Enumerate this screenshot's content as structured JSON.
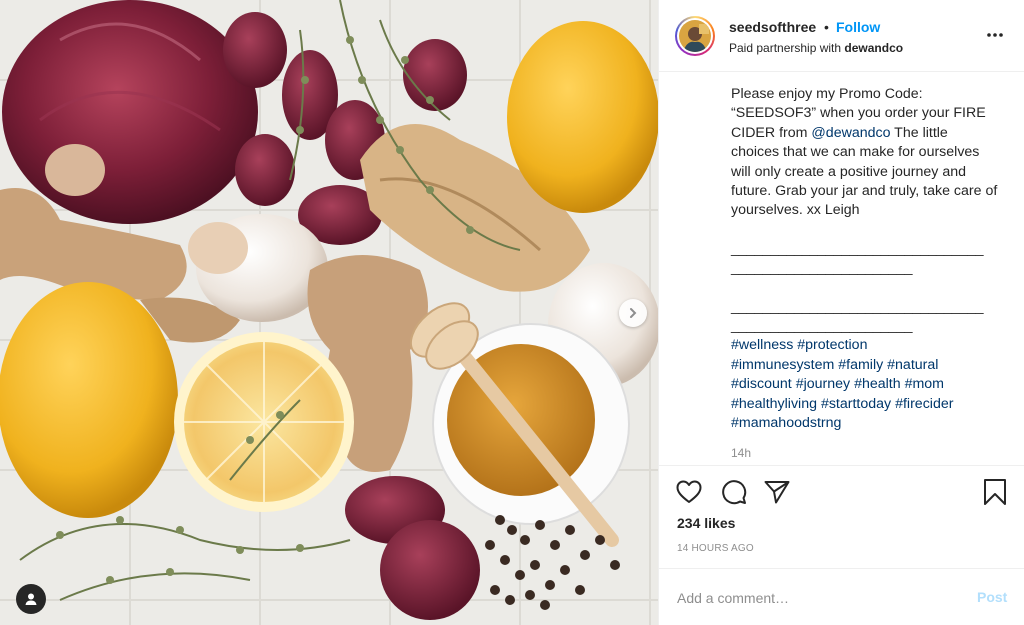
{
  "post": {
    "username": "seedsofthree",
    "separator": "•",
    "follow_label": "Follow",
    "partnership_prefix": "Paid partnership with",
    "partner": "dewandco",
    "caption_part1": "Please enjoy my Promo Code: “SEEDSOF3” when you order your FIRE CIDER from ",
    "caption_mention": "@dewandco",
    "caption_part2": " The little choices that we can make for ourselves will only create a positive journey and future. Grab your jar and truly, take care of yourselves. xx Leigh",
    "divider_line1": "________________________________",
    "divider_line2": "_______________________",
    "hashtags": [
      "#wellness",
      "#protection",
      "#immunesystem",
      "#family",
      "#natural",
      "#discount",
      "#journey",
      "#health",
      "#mom",
      "#healthyliving",
      "#starttoday",
      "#firecider",
      "#mamahoodstrng"
    ],
    "caption_time": "14h",
    "likes": "234 likes",
    "posted_ago": "14 HOURS AGO",
    "comment_placeholder": "Add a comment…",
    "post_label": "Post"
  },
  "icons": {
    "more": "more-options-icon",
    "like": "heart-icon",
    "comment": "comment-icon",
    "share": "share-icon",
    "save": "bookmark-icon",
    "next": "chevron-right-icon",
    "tag": "user-tag-icon"
  },
  "colors": {
    "link_blue": "#0095f6",
    "hashtag_blue": "#00376b",
    "text": "#262626",
    "muted": "#8e8e8e"
  }
}
